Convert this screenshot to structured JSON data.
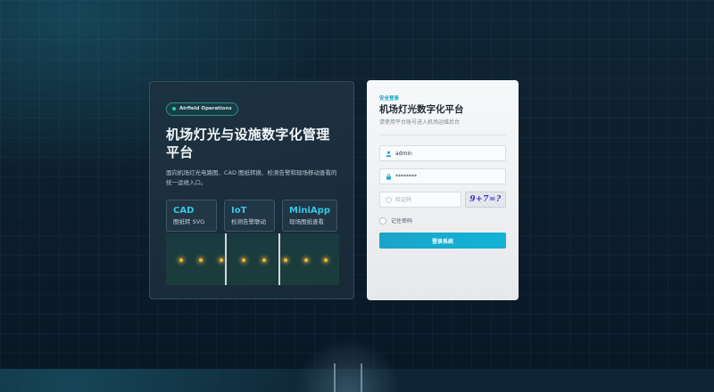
{
  "hero": {
    "badge": "Airfield Operations",
    "title": "机场灯光与设施数字化管理平台",
    "description": "面向机场灯光电路图、CAD 图纸转换、检测告警和现场移动查看的统一运维入口。",
    "features": [
      {
        "name": "CAD",
        "desc": "图纸转 SVG"
      },
      {
        "name": "IoT",
        "desc": "检测告警联动"
      },
      {
        "name": "MiniApp",
        "desc": "现场图纸查看"
      }
    ]
  },
  "login": {
    "eyebrow": "安全登录",
    "title": "机场灯光数字化平台",
    "subtitle": "请使用平台账号进入机场运维后台",
    "username_value": "admin",
    "password_value": "********",
    "captcha_placeholder": "验证码",
    "captcha_text": "9+7=?",
    "remember_label": "记住密码",
    "submit_label": "登录系统"
  },
  "colors": {
    "accent": "#12b3d6",
    "feature_title": "#38c6e6",
    "badge_dot": "#29d3a6",
    "runway_light": "#f5b53a"
  },
  "icons": [
    "user-icon",
    "lock-icon",
    "shield-icon"
  ]
}
